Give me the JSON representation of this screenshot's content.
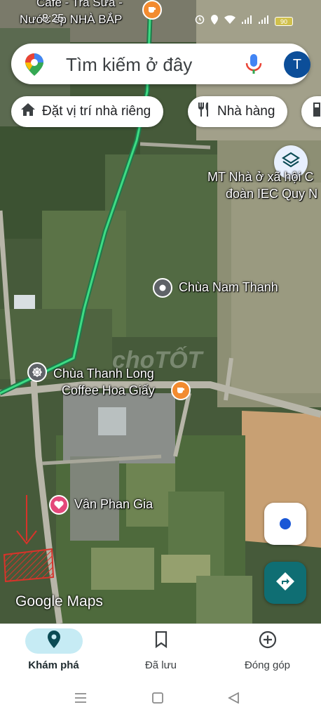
{
  "status_bar": {
    "time": "8:25",
    "battery": "90"
  },
  "search": {
    "placeholder": "Tìm kiếm ở đây",
    "avatar_letter": "T"
  },
  "chips": [
    {
      "label": "Đặt vị trí nhà riêng",
      "icon": "home-icon"
    },
    {
      "label": "Nhà hàng",
      "icon": "restaurant-icon"
    },
    {
      "label": "",
      "icon": "gas-station-icon"
    }
  ],
  "map": {
    "labels": {
      "cafe_top_line1": "Cafe - Trà Sữa -",
      "cafe_top_line2": "Nước ép NHÀ BẮP",
      "mt_line1": "MT Nhà ở xã hội C",
      "mt_line2": "đoàn IEC Quy N",
      "chua_nam_thanh": "Chùa Nam Thanh",
      "chua_thanh_long": "Chùa Thanh Long",
      "coffee_hoa_giay": "Coffee Hoa Giấy",
      "van_phan_gia": "Vân Phan Gia",
      "watermark": "choTỐT"
    },
    "logo_text": "Google Maps",
    "colors": {
      "route": "#3ddc84",
      "cafe_pin": "#f28b30",
      "temple_pin": "#5f6368",
      "heart_pin": "#e4477a",
      "annotation": "#d8332a"
    }
  },
  "bottom_nav": [
    {
      "label": "Khám phá",
      "icon": "explore-pin-icon",
      "active": true
    },
    {
      "label": "Đã lưu",
      "icon": "bookmark-icon",
      "active": false
    },
    {
      "label": "Đóng góp",
      "icon": "add-circle-icon",
      "active": false
    }
  ]
}
